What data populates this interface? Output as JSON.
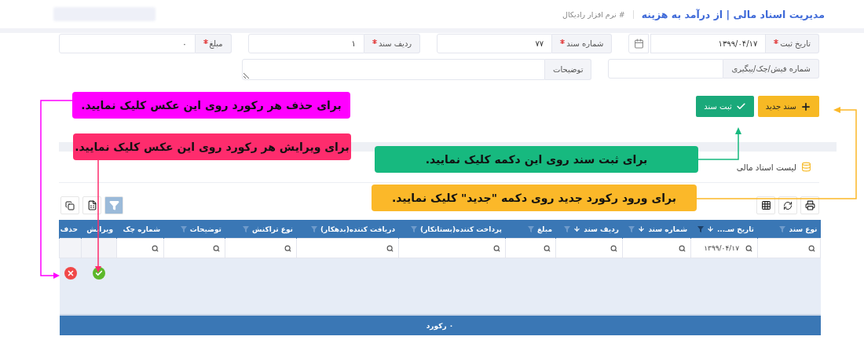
{
  "header": {
    "title": "مدیریت اسناد مالی | از درآمد به هزینه",
    "subtitle": "# نرم افزار رادیکال"
  },
  "form": {
    "rows": [
      [
        {
          "label": "تاریخ ثبت",
          "required": true,
          "value": "۱۳۹۹/۰۴/۱۷",
          "kind": "date"
        },
        {
          "label": "شماره سند",
          "required": true,
          "value": "۷۷",
          "kind": "text"
        },
        {
          "label": "ردیف سند",
          "required": true,
          "value": "۱",
          "kind": "text"
        },
        {
          "label": "مبلغ",
          "required": true,
          "value": "۰",
          "kind": "text"
        }
      ],
      [
        {
          "label": "شماره فیش/چک/پیگیری",
          "required": false,
          "kind": "text"
        },
        {
          "label": "توضیحات",
          "required": false,
          "kind": "textarea"
        }
      ]
    ]
  },
  "actions": [
    {
      "label": "سند جدید",
      "kind": "new"
    },
    {
      "label": "ثبت سند",
      "kind": "save"
    }
  ],
  "list_title": "لیست اسناد مالی",
  "table": {
    "columns": [
      {
        "label": "نوع سند",
        "sorted": false,
        "filterable": true,
        "filter_active": false
      },
      {
        "label": "تاریخ سـ...",
        "sorted": true,
        "filterable": true,
        "filter_active": true
      },
      {
        "label": "شماره سند",
        "sorted": true,
        "filterable": true,
        "filter_active": false
      },
      {
        "label": "ردیف سند",
        "sorted": true,
        "filterable": true,
        "filter_active": false
      },
      {
        "label": "مبلغ",
        "sorted": false,
        "filterable": true,
        "filter_active": false
      },
      {
        "label": "پرداخت کننده(بستانکار)",
        "sorted": false,
        "filterable": true,
        "filter_active": false
      },
      {
        "label": "دریافت کننده(بدهکار)",
        "sorted": false,
        "filterable": true,
        "filter_active": false
      },
      {
        "label": "نوع تراکنش",
        "sorted": false,
        "filterable": true,
        "filter_active": false
      },
      {
        "label": "توضیحات",
        "sorted": false,
        "filterable": true,
        "filter_active": false
      },
      {
        "label": "شماره چک",
        "sorted": false,
        "filterable": false
      },
      {
        "label": "ویرایش",
        "sorted": false,
        "filterable": false
      },
      {
        "label": "حذف",
        "sorted": false,
        "filterable": false
      }
    ],
    "filter_row": [
      {
        "kind": "search"
      },
      {
        "kind": "search",
        "value": "۱۳۹۹/۰۴/۱۷"
      },
      {
        "kind": "search"
      },
      {
        "kind": "search"
      },
      {
        "kind": "search"
      },
      {
        "kind": "search"
      },
      {
        "kind": "search"
      },
      {
        "kind": "search"
      },
      {
        "kind": "search"
      },
      {
        "kind": "search"
      },
      {
        "kind": "disabled"
      },
      {
        "kind": "disabled"
      }
    ],
    "rows": [
      {
        "actions": [
          {
            "kind": "edit"
          },
          {
            "kind": "delete"
          }
        ]
      }
    ],
    "footer": "۰ رکورد"
  },
  "annotations": [
    {
      "text": "برای حذف هر رکورد روی این عکس کلیک نمایید.",
      "color": "#ff00ff"
    },
    {
      "text": "برای ویرایش هر رکورد روی این عکس کلیک نمایید.",
      "color": "#fe2c6d"
    },
    {
      "text": "برای ثبت سند روی این دکمه کلیک نمایید.",
      "color": "#17b97f"
    },
    {
      "text": "برای ورود رکورد جدید روی دکمه \"جدید\" کلیک نمایید.",
      "color": "#fbb829"
    }
  ]
}
